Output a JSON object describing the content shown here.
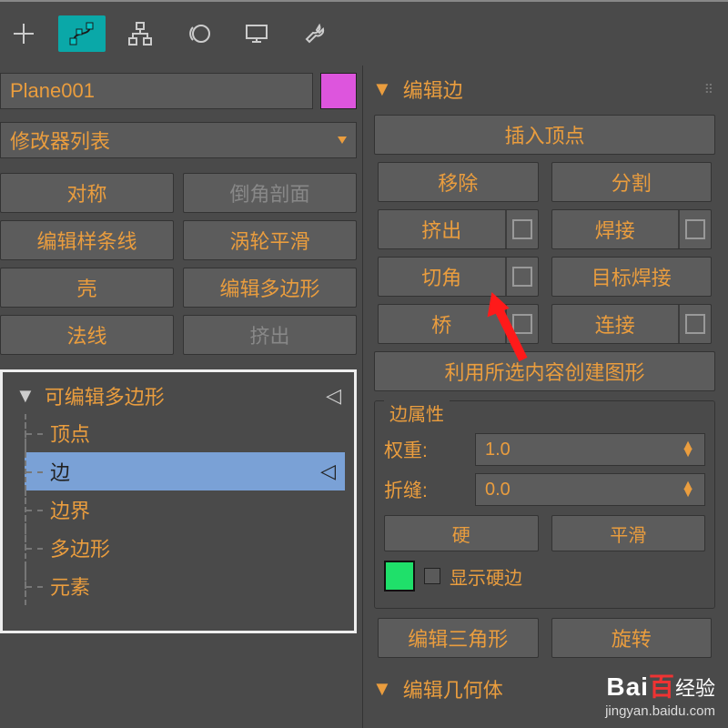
{
  "toolbar": {
    "icons": [
      "add-icon",
      "transform-icon",
      "hierarchy-icon",
      "display-icon",
      "render-icon",
      "utilities-icon"
    ]
  },
  "object": {
    "name": "Plane001",
    "color": "#dd55dd"
  },
  "modifier_dropdown": "修改器列表",
  "modifier_buttons": [
    [
      {
        "label": "对称",
        "disabled": false
      },
      {
        "label": "倒角剖面",
        "disabled": true
      }
    ],
    [
      {
        "label": "编辑样条线",
        "disabled": false
      },
      {
        "label": "涡轮平滑",
        "disabled": false
      }
    ],
    [
      {
        "label": "壳",
        "disabled": false
      },
      {
        "label": "编辑多边形",
        "disabled": false
      }
    ],
    [
      {
        "label": "法线",
        "disabled": false
      },
      {
        "label": "挤出",
        "disabled": true
      }
    ]
  ],
  "stack": {
    "header": "可编辑多边形",
    "items": [
      "顶点",
      "边",
      "边界",
      "多边形",
      "元素"
    ],
    "selected_index": 1
  },
  "rollout_edit_edge": {
    "title": "编辑边",
    "insert_vertex": "插入顶点",
    "rows": [
      [
        {
          "label": "移除",
          "box": false
        },
        {
          "label": "分割",
          "box": false
        }
      ],
      [
        {
          "label": "挤出",
          "box": true
        },
        {
          "label": "焊接",
          "box": true
        }
      ],
      [
        {
          "label": "切角",
          "box": true
        },
        {
          "label": "目标焊接",
          "box": false
        }
      ],
      [
        {
          "label": "桥",
          "box": true
        },
        {
          "label": "连接",
          "box": true
        }
      ]
    ],
    "create_shape": "利用所选内容创建图形"
  },
  "edge_attrs": {
    "title": "边属性",
    "weight_label": "权重:",
    "weight_value": "1.0",
    "crease_label": "折缝:",
    "crease_value": "0.0",
    "hard": "硬",
    "smooth": "平滑",
    "show_hard_color": "#1fe06a",
    "show_hard_label": "显示硬边"
  },
  "bottom_row": [
    {
      "label": "编辑三角形"
    },
    {
      "label": "旋转"
    }
  ],
  "rollout_geo": {
    "title": "编辑几何体"
  },
  "watermark": {
    "brand": "Bai",
    "brand2": "百",
    "label": "经验",
    "url": "jingyan.baidu.com"
  }
}
